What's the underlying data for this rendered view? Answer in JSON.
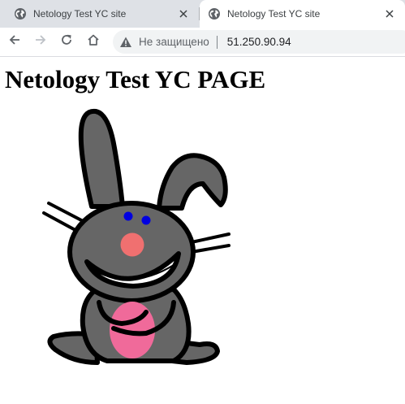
{
  "browser": {
    "tabs": [
      {
        "title": "Netology Test YC site",
        "active": false,
        "favicon": "globe-icon"
      },
      {
        "title": "Netology Test YC site",
        "active": true,
        "favicon": "globe-icon"
      }
    ],
    "toolbar": {
      "back_icon": "back-arrow-icon",
      "forward_icon": "forward-arrow-icon",
      "reload_icon": "reload-icon",
      "home_icon": "home-icon"
    },
    "address_bar": {
      "security_icon": "warning-triangle-icon",
      "security_label": "Не защищено",
      "url": "51.250.90.94"
    }
  },
  "page": {
    "heading": "Netology Test YC PAGE",
    "image": "happy-bunny-cartoon"
  },
  "colors": {
    "tabstrip_bg": "#dee1e6",
    "omnibox_bg": "#f1f3f4",
    "bunny_body": "#666666",
    "bunny_nose": "#f07070",
    "bunny_belly": "#f06a9a",
    "bunny_eyes": "#0000e0"
  }
}
